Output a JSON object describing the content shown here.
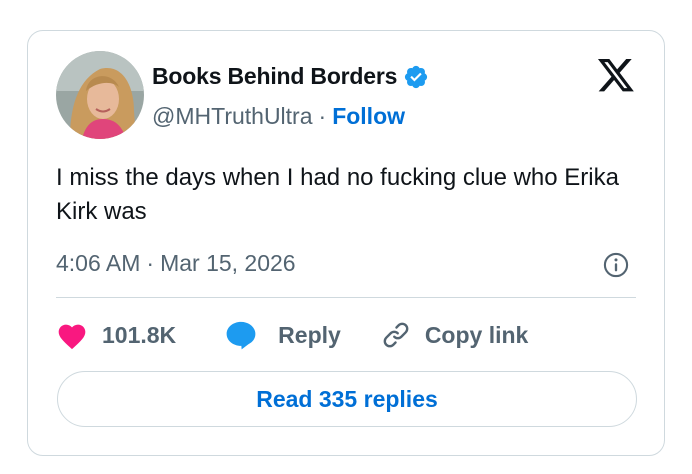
{
  "author": {
    "display_name": "Books Behind Borders",
    "handle": "@MHTruthUltra",
    "separator": "·",
    "follow_label": "Follow",
    "verified_icon": "verified-badge-icon",
    "verified_color": "#1d9bf0"
  },
  "platform_icon": "x-logo-icon",
  "tweet": {
    "text": "I miss the days when I had no fucking clue who Erika Kirk was",
    "time": "4:06 AM",
    "date_separator": "·",
    "date": "Mar 15, 2026"
  },
  "actions": {
    "likes": "101.8K",
    "like_color": "#f91880",
    "reply_label": "Reply",
    "reply_color": "#1d9bf0",
    "copy_label": "Copy link"
  },
  "read_replies_label": "Read 335 replies",
  "accent_color": "#006fd6"
}
